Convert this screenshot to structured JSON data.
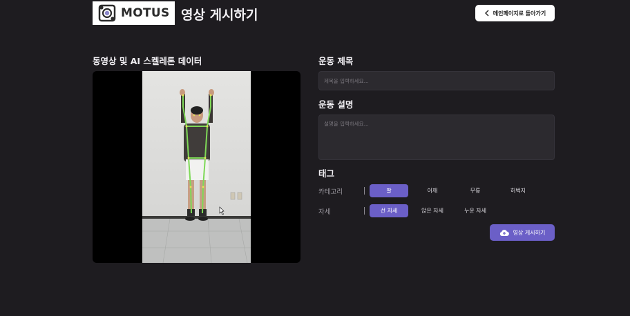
{
  "header": {
    "logo_text": "MOTUS",
    "page_title": "영상 게시하기",
    "back_button_label": "메인페이지로 돌아가기"
  },
  "video": {
    "heading": "동영상 및 AI 스켈레톤 데이터"
  },
  "form": {
    "title_label": "운동 제목",
    "title_placeholder": "제목을 입력하세요...",
    "title_value": "",
    "description_label": "운동 설명",
    "description_placeholder": "설명을 입력하세요...",
    "description_value": "",
    "tags_label": "태그",
    "category_label": "카테고리",
    "categories": [
      {
        "label": "팔",
        "selected": true
      },
      {
        "label": "어깨",
        "selected": false
      },
      {
        "label": "무릎",
        "selected": false
      },
      {
        "label": "허벅지",
        "selected": false
      }
    ],
    "posture_label": "자세",
    "postures": [
      {
        "label": "선 자세",
        "selected": true
      },
      {
        "label": "앉은 자세",
        "selected": false
      },
      {
        "label": "누운 자세",
        "selected": false
      }
    ],
    "submit_label": "영상 게시하기"
  },
  "colors": {
    "background": "#1e1c20",
    "accent": "#6b5fc7",
    "skeleton": "#7ed957",
    "input_bg": "#2c2a2f"
  },
  "icons": {
    "logo": "motus-logo-icon",
    "back": "chevron-left-icon",
    "submit": "cloud-upload-icon"
  }
}
